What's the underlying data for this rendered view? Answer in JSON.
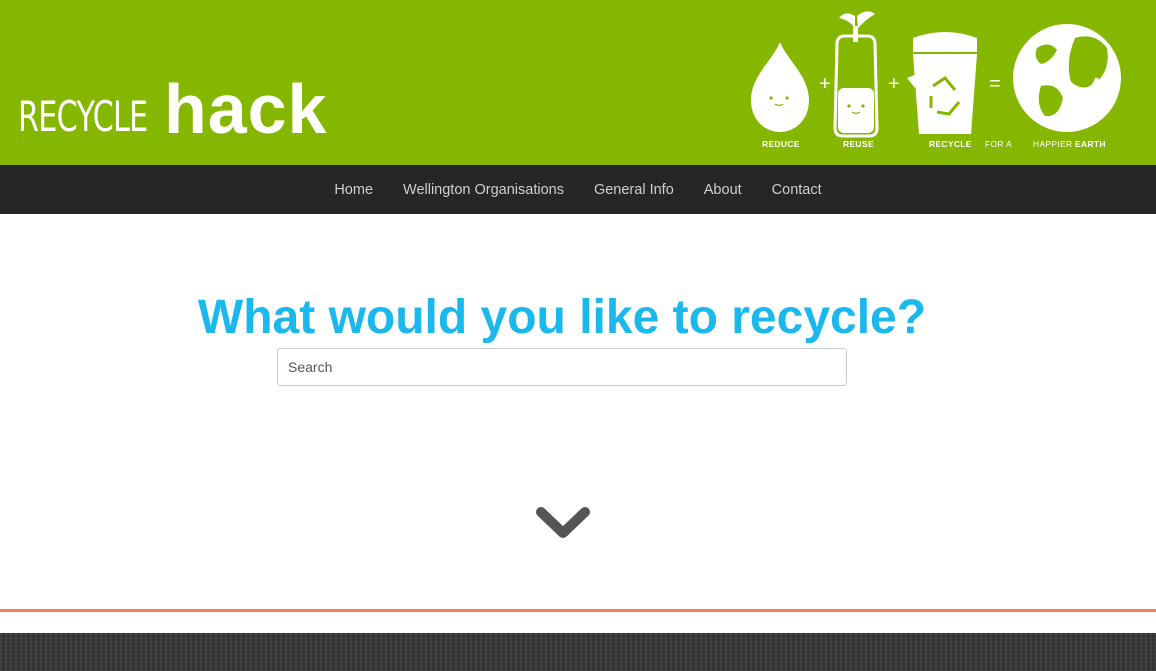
{
  "header": {
    "logo_part1": "RECYCLE",
    "logo_part2": "hack",
    "banner_labels": [
      "REDUCE",
      "REUSE",
      "RECYCLE",
      "FOR A",
      "HAPPIER",
      "EARTH"
    ],
    "accent_color": "#86b700"
  },
  "nav": {
    "items": [
      "Home",
      "Wellington Organisations",
      "General Info",
      "About",
      "Contact"
    ]
  },
  "main": {
    "headline": "What would you like to recycle?",
    "search_placeholder": "Search",
    "headline_color": "#1ab8ec",
    "scroll_icon": "chevron-down-icon"
  },
  "footer": {
    "divider_color": "#f0834d"
  }
}
